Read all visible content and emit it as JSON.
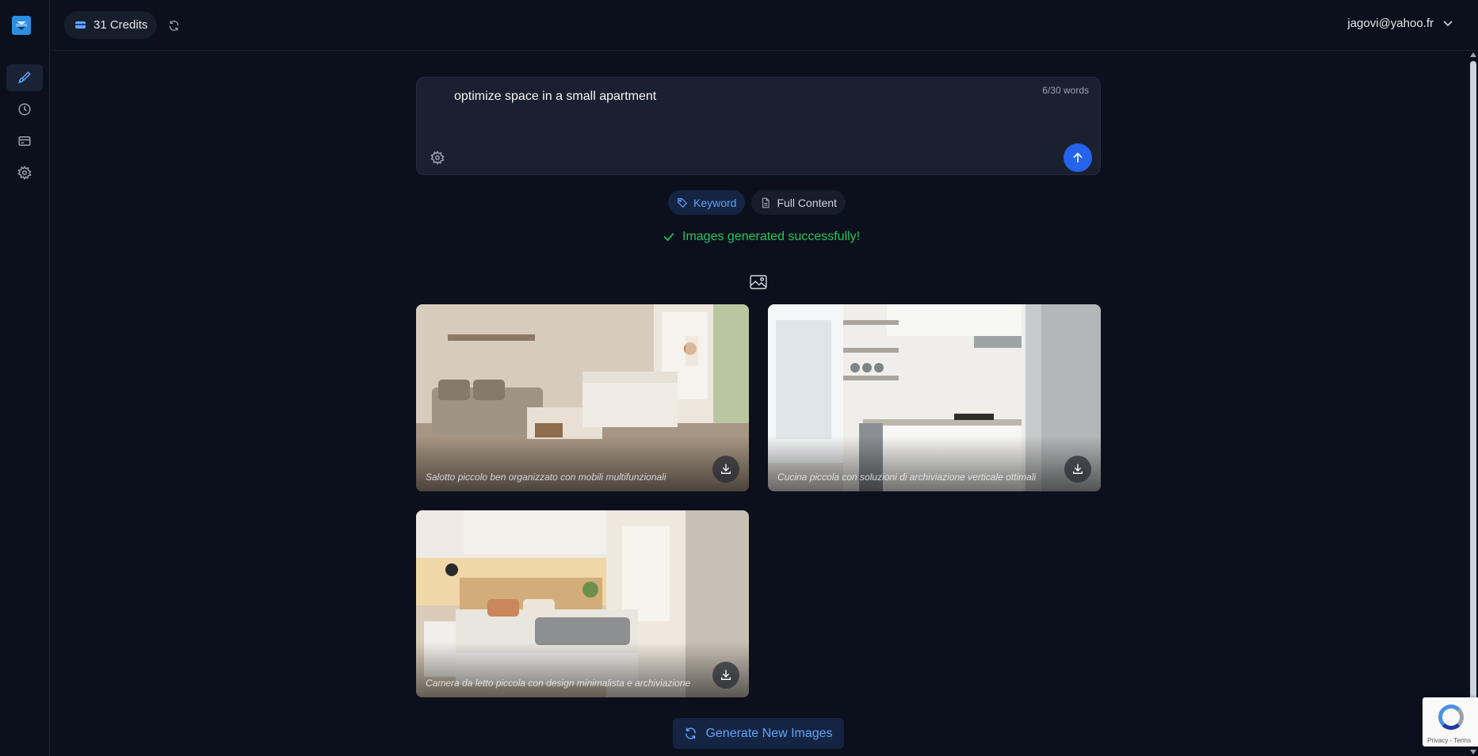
{
  "topbar": {
    "credits_label": "31 Credits",
    "user_email": "jagovi@yahoo.fr"
  },
  "sidebar": {
    "items": [
      {
        "name": "brush-icon",
        "active": true
      },
      {
        "name": "history-icon",
        "active": false
      },
      {
        "name": "billing-card-icon",
        "active": false
      },
      {
        "name": "settings-icon",
        "active": false
      }
    ]
  },
  "prompt": {
    "text": "optimize space in a small apartment",
    "word_count": "6/30 words"
  },
  "modes": {
    "keyword_label": "Keyword",
    "full_content_label": "Full Content",
    "active": "Keyword"
  },
  "status": {
    "message": "Images generated successfully!"
  },
  "images": [
    {
      "caption": "Salotto piccolo ben organizzato con mobili multifunzionali",
      "scene": "living-room"
    },
    {
      "caption": "Cucina piccola con soluzioni di archiviazione verticale ottimali",
      "scene": "kitchen"
    },
    {
      "caption": "Camera da letto piccola con design minimalista e archiviazione",
      "scene": "bedroom"
    }
  ],
  "actions": {
    "generate_label": "Generate New Images"
  },
  "recaptcha": {
    "footer": "Privacy - Terms"
  },
  "colors": {
    "accent": "#2563eb",
    "accent_text": "#60a5fa",
    "success": "#22c55e",
    "background": "#0b101c"
  }
}
